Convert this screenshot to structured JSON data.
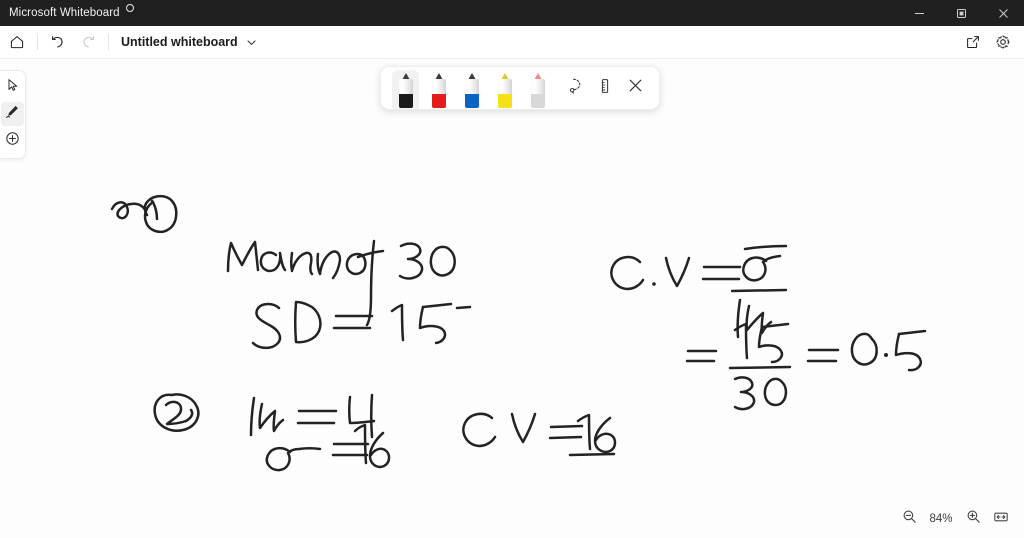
{
  "window": {
    "app_title": "Microsoft Whiteboard",
    "badge_icon": "circle-badge-icon",
    "controls": {
      "minimize": "minimize-icon",
      "maximize": "restore-icon",
      "close": "close-icon"
    },
    "titlebar_color": "#202020"
  },
  "command_bar": {
    "home_icon": "home-icon",
    "undo_icon": "undo-icon",
    "redo_icon": "redo-icon",
    "redo_disabled": true,
    "document_title": "Untitled whiteboard",
    "title_chevron_icon": "chevron-down-icon",
    "share_icon": "share-icon",
    "settings_icon": "gear-icon"
  },
  "left_rail": {
    "items": [
      {
        "name": "select-cursor",
        "icon": "cursor-arrow-icon",
        "active": false
      },
      {
        "name": "pen",
        "icon": "pen-icon",
        "active": true
      },
      {
        "name": "insert",
        "icon": "plus-circle-icon",
        "active": false
      }
    ]
  },
  "pen_toolbar": {
    "pens": [
      {
        "label": "Black pen",
        "color": "#1a1a1a",
        "selected": true
      },
      {
        "label": "Red pen",
        "color": "#e21b1b",
        "selected": false
      },
      {
        "label": "Blue pen",
        "color": "#0a63c2",
        "selected": false
      },
      {
        "label": "Yellow highlighter",
        "color": "#f5e118",
        "selected": false
      },
      {
        "label": "Pink pen",
        "color": "#f08a8a",
        "selected": false
      }
    ],
    "tools": [
      {
        "label": "Lasso select",
        "icon": "lasso-select-icon"
      },
      {
        "label": "Ruler",
        "icon": "ruler-icon"
      },
      {
        "label": "Close",
        "icon": "close-icon"
      }
    ]
  },
  "canvas": {
    "background": "#fdfdfd",
    "handwriting": [
      {
        "id": "problem-1-marker",
        "text": "(1)"
      },
      {
        "id": "problem-1-line-1",
        "text": "Mean of 30"
      },
      {
        "id": "problem-1-line-2",
        "text": "SD = 15"
      },
      {
        "id": "cv-formula-label",
        "text": "C.V ="
      },
      {
        "id": "cv-formula-numerator",
        "text": "σ"
      },
      {
        "id": "cv-formula-denominator",
        "text": "μ"
      },
      {
        "id": "cv-eval-equals",
        "text": "="
      },
      {
        "id": "cv-eval-numerator",
        "text": "15"
      },
      {
        "id": "cv-eval-denominator",
        "text": "30"
      },
      {
        "id": "cv-eval-result",
        "text": "= 0.5"
      },
      {
        "id": "problem-2-marker",
        "text": "(2)"
      },
      {
        "id": "problem-2-line-1",
        "text": "μ = 4"
      },
      {
        "id": "problem-2-line-2",
        "text": "σ = 16"
      },
      {
        "id": "problem-2-cv-label",
        "text": "CV ="
      },
      {
        "id": "problem-2-cv-value",
        "text": "16"
      }
    ]
  },
  "zoom_control": {
    "zoom_out_icon": "zoom-out-icon",
    "level": "84%",
    "zoom_in_icon": "zoom-in-icon",
    "fit_icon": "fit-to-screen-icon"
  }
}
